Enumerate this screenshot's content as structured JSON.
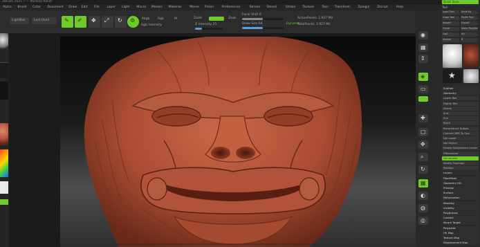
{
  "titlebar": {
    "text": "ZBrush 2021.7 — Monkey Relief"
  },
  "menu": [
    "Alpha",
    "Brush",
    "Color",
    "Document",
    "Draw",
    "Edit",
    "File",
    "Layer",
    "Light",
    "Macro",
    "Marker",
    "Material",
    "Movie",
    "Picker",
    "Preferences",
    "Render",
    "Stencil",
    "Stroke",
    "Texture",
    "Tool",
    "Transform",
    "Zplugin",
    "Zscript",
    "Help"
  ],
  "toolbar": {
    "lightbox": "LightBox",
    "quicksave": "Quick Sketch",
    "last_used": "Last Used",
    "edit": "Edit",
    "draw": "Draw",
    "move": "Move",
    "scale": "Scale",
    "rotate": "Rotate",
    "mrgb": "Mrgb",
    "rgb": "Rgb",
    "m": "M",
    "zadd": "Zadd",
    "zsub": "Zsub",
    "rgb_intensity": "Rgb Intensity",
    "z_intensity": "Z Intensity 25",
    "focal_shift": "Focal Shift 0",
    "draw_size": "Draw Size 64",
    "dynamic": "Dynamic",
    "active_points": "ActivePoints: 1.927 Mil",
    "total_points": "TotalPoints: 1.927 Mil"
  },
  "status_indicators": {
    "z_intensity_level": 0.25,
    "draw_size_level": 0.5
  },
  "right_tray_title": "Quick Save",
  "tool_panel": {
    "title": "Tool",
    "buttons": [
      "Load Tool",
      "Save As",
      "Copy Tool",
      "Paste Tool",
      "Import",
      "Export",
      "Clone",
      "Make PolyMesh3D",
      "GoZ",
      "All",
      "Visible",
      "R"
    ],
    "sections": [
      "Subtool",
      "Geometry",
      "Layers",
      "FiberMesh",
      "Geometry HD",
      "Preview",
      "Surface",
      "Deformation",
      "Masking",
      "Visibility",
      "Polygroups",
      "Contact",
      "Morph Target",
      "Polypaint",
      "UV Map",
      "Texture Map",
      "Displacement Map"
    ],
    "geometry_items": [
      "Lower Res",
      "Higher Res",
      "Divide",
      "Smt",
      "Suv",
      "ReUV",
      "Reconstruct Subdiv",
      "Convert BPR To Geo",
      "Del Lower",
      "Del Higher",
      "Freeze SubDivision Levels",
      "ZRemesher",
      "Dynamesh",
      "Modify Topology",
      "Position"
    ],
    "highlighted": "DynaMesh"
  },
  "colors": {
    "accent": "#6fcb2c",
    "model": "#b4553a",
    "panel": "#2a2a2a"
  }
}
